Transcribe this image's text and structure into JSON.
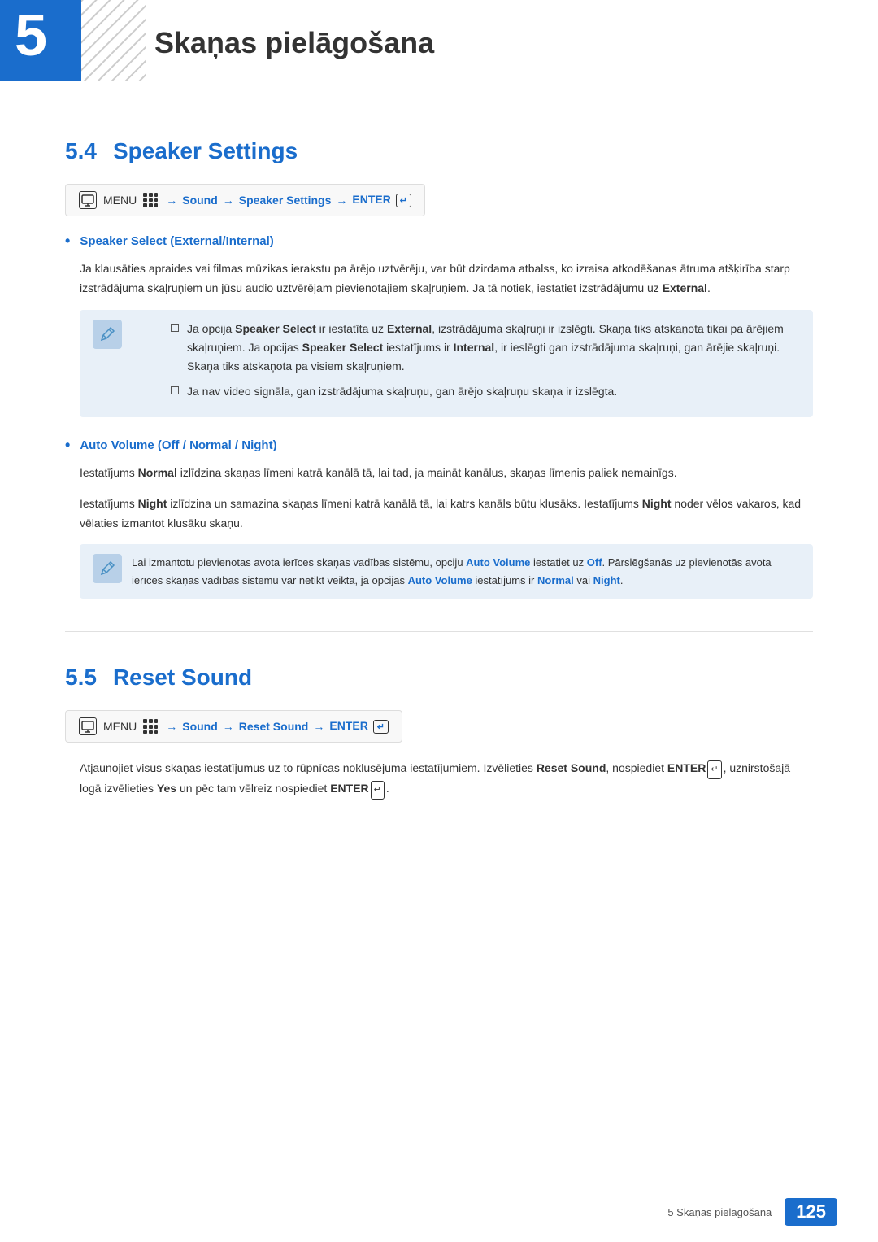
{
  "page": {
    "background_color": "#ffffff"
  },
  "chapter": {
    "number": "5",
    "title": "Skaņas pielāgošana"
  },
  "section_4": {
    "number": "5.4",
    "title": "Speaker Settings",
    "menu_path": {
      "menu_label": "MENU",
      "arrow1": "→",
      "sound": "Sound",
      "arrow2": "→",
      "item": "Speaker Settings",
      "arrow3": "→",
      "enter": "ENTER"
    },
    "bullet1": {
      "title": "Speaker Select (External/Internal)",
      "body": "Ja klausāties apraides vai filmas mūzikas ierakstu pa ārējo uztvērēju, var būt dzirdama atbalss, ko izraisa atkodēšanas ātruma atšķirība starp izstrādājuma skaļruņiem un jūsu audio uztvērējam pievienotajiem skaļruņiem. Ja tā notiek, iestatiet izstrādājumu uz External.",
      "note": {
        "sub1": "Ja opcija Speaker Select ir iestatīta uz External, izstrādājuma skaļruņi ir izslēgti. Skaņa tiks atskaņota tikai pa ārējiem skaļruņiem. Ja opcijas Speaker Select iestatījums ir Internal, ir ieslēgti gan izstrādājuma skaļruņi, gan ārējie skaļruņi. Skaņa tiks atskaņota pa visiem skaļruņiem.",
        "sub2": "Ja nav video signāla, gan izstrādājuma skaļruņu, gan ārējo skaļruņu skaņa ir izslēgta."
      }
    },
    "bullet2": {
      "title": "Auto Volume (Off / Normal / Night)",
      "body1": "Iestatījums Normal izlīdzina skaņas līmeni katrā kanālā tā, lai tad, ja maināt kanālus, skaņas līmenis paliek nemainīgs.",
      "body2": "Iestatījums Night izlīdzina un samazina skaņas līmeni katrā kanālā tā, lai katrs kanāls būtu klusāks. Iestatījums Night noder vēlos vakaros, kad vēlaties izmantot klusāku skaņu.",
      "note": "Lai izmantotu pievienotas avota ierīces skaņas vadības sistēmu, opciju Auto Volume iestatiet uz Off. Pārslēgšanās uz pievienotās avota ierīces skaņas vadības sistēmu var netikt veikta, ja opcijas Auto Volume iestatījums ir Normal vai Night."
    }
  },
  "section_5": {
    "number": "5.5",
    "title": "Reset Sound",
    "menu_path": {
      "menu_label": "MENU",
      "arrow1": "→",
      "sound": "Sound",
      "arrow2": "→",
      "item": "Reset Sound",
      "arrow3": "→",
      "enter": "ENTER"
    },
    "body": "Atjaunojiet visus skaņas iestatījumus uz to rūpnīcas noklusējuma iestatījumiem. Izvēlieties Reset Sound, nospiediet ENTER[",
    "body2": "], uznirstošajā logā izvēlieties Yes un pēc tam vēlreiz nospiediet ENTER["
  },
  "footer": {
    "chapter_ref": "5 Skaņas pielāgošana",
    "page_number": "125"
  }
}
